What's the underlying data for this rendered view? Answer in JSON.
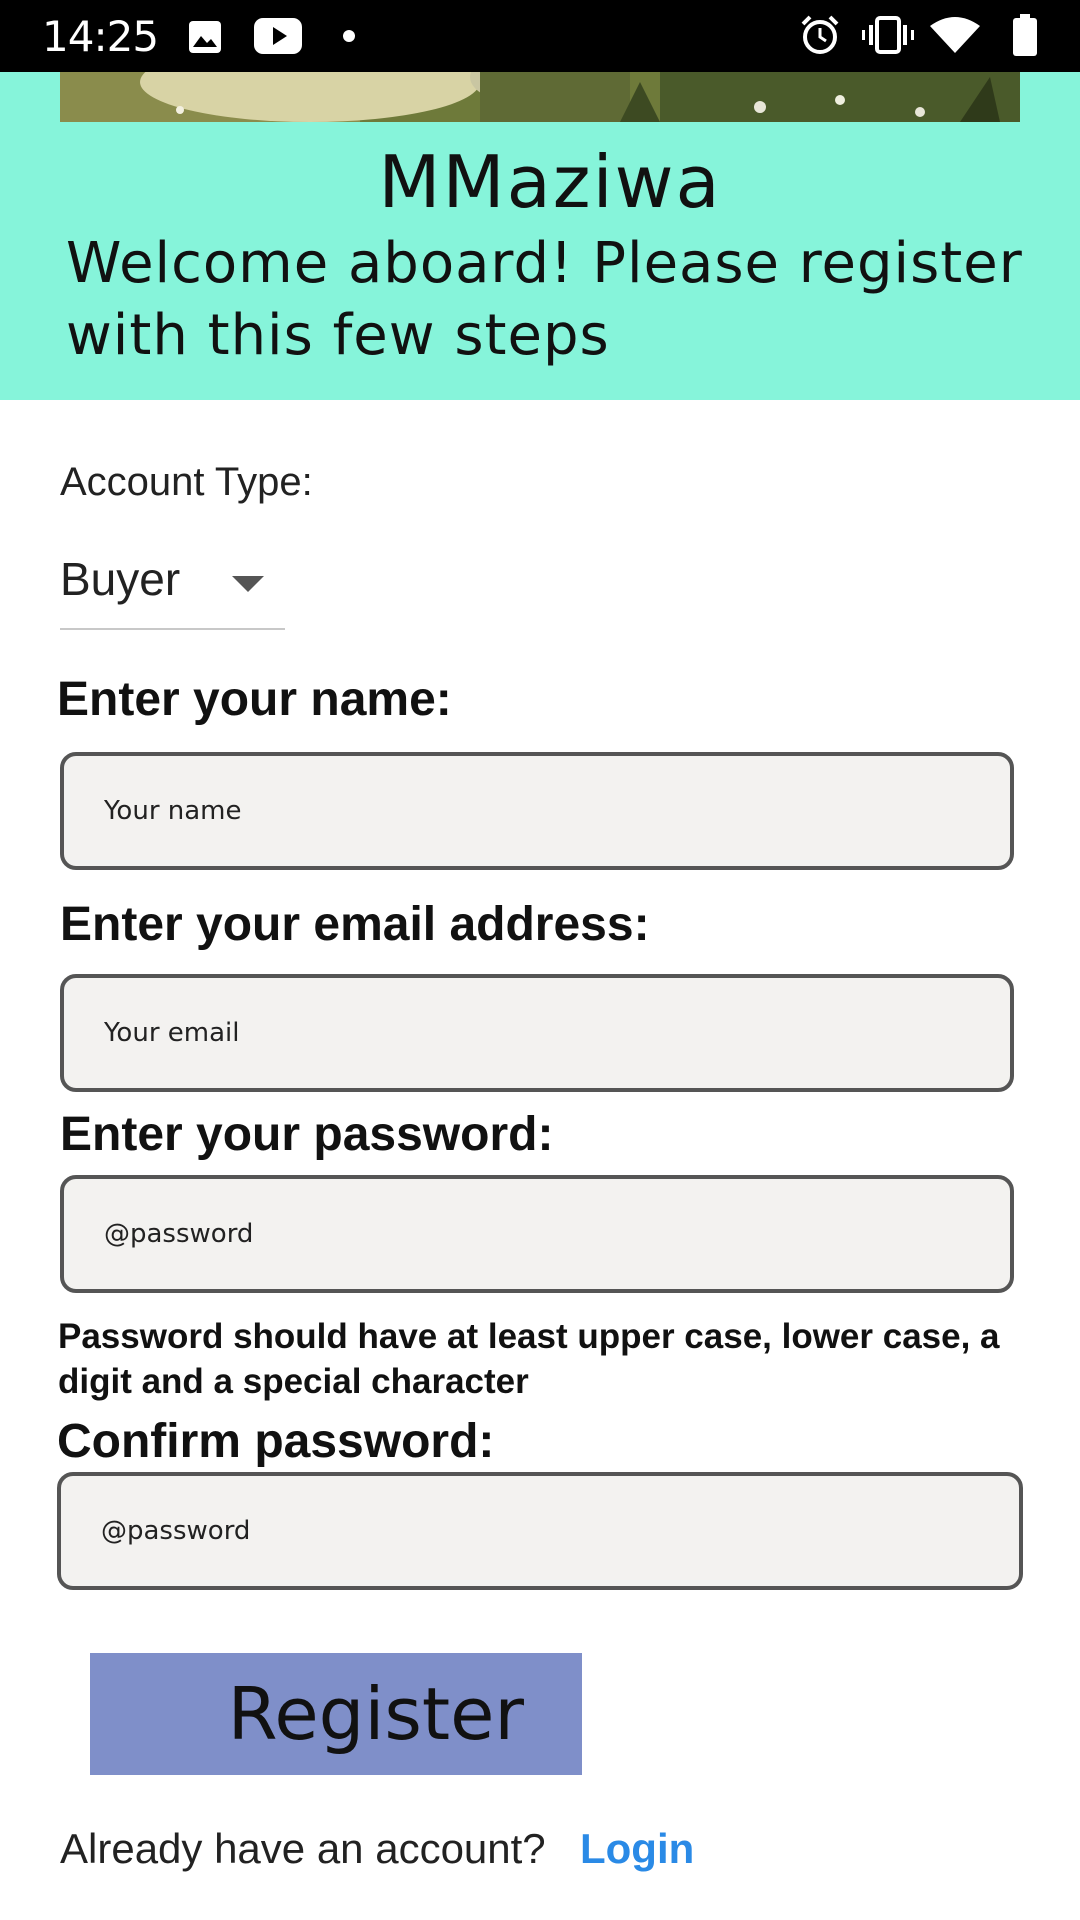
{
  "status_bar": {
    "time": "14:25",
    "left_icons": [
      "image-icon",
      "youtube-icon",
      "dot-icon"
    ],
    "right_icons": [
      "alarm-icon",
      "vibrate-icon",
      "wifi-icon",
      "battery-icon"
    ]
  },
  "header": {
    "app_name": "MMaziwa",
    "welcome_text": "Welcome aboard! Please register with this few steps",
    "background_color": "#86f4da"
  },
  "account_type": {
    "label": "Account Type:",
    "selected": "Buyer"
  },
  "form": {
    "name": {
      "label": "Enter your name:",
      "placeholder": "Your name",
      "value": ""
    },
    "email": {
      "label": "Enter your email address:",
      "placeholder": "Your email",
      "value": ""
    },
    "password": {
      "label": "Enter your password:",
      "placeholder": "@password",
      "value": "",
      "hint": "Password should have at least upper case, lower case, a digit and a special character"
    },
    "confirm_password": {
      "label": "Confirm password:",
      "placeholder": "@password",
      "value": ""
    }
  },
  "actions": {
    "register_label": "Register",
    "register_color": "#7f8fc9",
    "already_text": "Already have an account?",
    "login_label": "Login",
    "login_color": "#2a8ae6"
  }
}
